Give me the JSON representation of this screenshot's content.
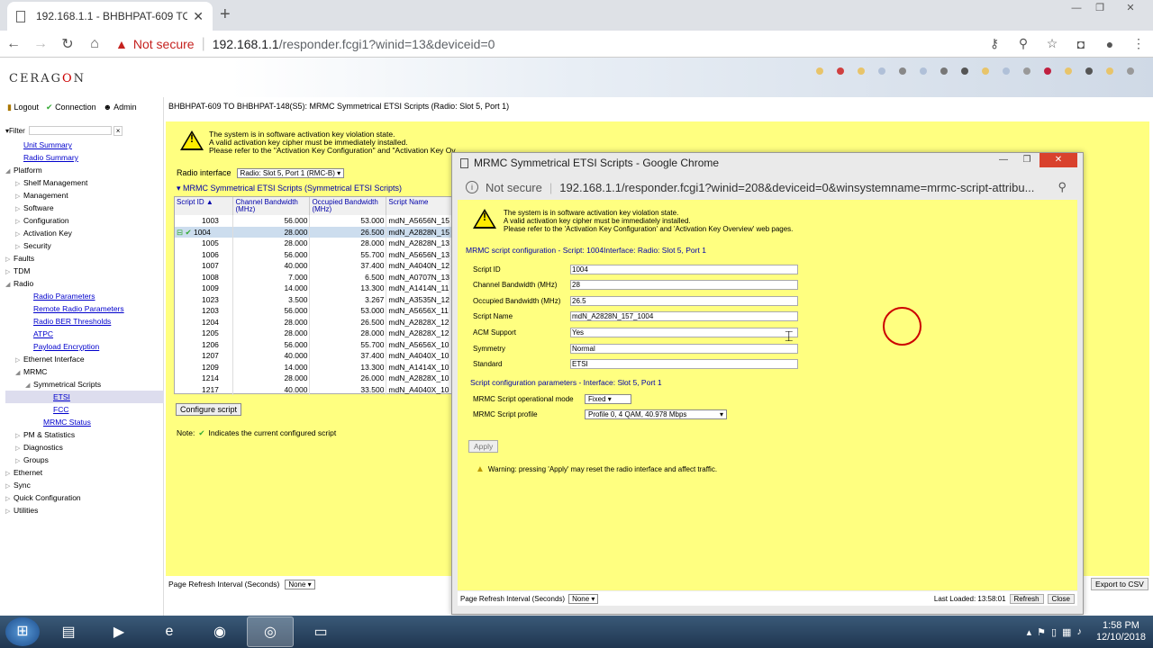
{
  "browser": {
    "tab_title": "192.168.1.1 - BHBHPAT-609 TO B",
    "tab_close": "✕",
    "new_tab": "+",
    "window_buttons": [
      "—",
      "❐",
      "✕"
    ],
    "not_secure": "Not secure",
    "url_host": "192.168.1.1",
    "url_path": "/responder.fcgi1?winid=13&deviceid=0"
  },
  "banner": {
    "logo_pre": "CERAG",
    "logo_o": "O",
    "logo_post": "N",
    "dot_colors": [
      "#e8c46a",
      "#d04040",
      "#e8c46a",
      "#b0c0d8",
      "#888",
      "#b0c0d8",
      "#777",
      "#555",
      "#e8c46a",
      "#b0c0d8",
      "#999",
      "#c02040",
      "#e8c46a",
      "#555",
      "#e8c46a",
      "#999"
    ]
  },
  "topnav": {
    "logout": "Logout",
    "connection": "Connection",
    "admin": "Admin"
  },
  "filter_label": "Filter",
  "tree": [
    {
      "label": "Unit Summary",
      "indent": 1,
      "type": "link"
    },
    {
      "label": "Radio Summary",
      "indent": 1,
      "type": "link"
    },
    {
      "label": "Platform",
      "indent": 0,
      "type": "open"
    },
    {
      "label": "Shelf Management",
      "indent": 1,
      "type": "closed"
    },
    {
      "label": "Management",
      "indent": 1,
      "type": "closed"
    },
    {
      "label": "Software",
      "indent": 1,
      "type": "closed"
    },
    {
      "label": "Configuration",
      "indent": 1,
      "type": "closed"
    },
    {
      "label": "Activation Key",
      "indent": 1,
      "type": "closed"
    },
    {
      "label": "Security",
      "indent": 1,
      "type": "closed"
    },
    {
      "label": "Faults",
      "indent": 0,
      "type": "closed"
    },
    {
      "label": "TDM",
      "indent": 0,
      "type": "closed"
    },
    {
      "label": "Radio",
      "indent": 0,
      "type": "open"
    },
    {
      "label": "Radio Parameters",
      "indent": 2,
      "type": "link"
    },
    {
      "label": "Remote Radio Parameters",
      "indent": 2,
      "type": "link"
    },
    {
      "label": "Radio BER Thresholds",
      "indent": 2,
      "type": "link"
    },
    {
      "label": "ATPC",
      "indent": 2,
      "type": "link"
    },
    {
      "label": "Payload Encryption",
      "indent": 2,
      "type": "link"
    },
    {
      "label": "Ethernet Interface",
      "indent": 1,
      "type": "closed"
    },
    {
      "label": "MRMC",
      "indent": 1,
      "type": "open"
    },
    {
      "label": "Symmetrical Scripts",
      "indent": 2,
      "type": "open"
    },
    {
      "label": "ETSI",
      "indent": 4,
      "type": "sel"
    },
    {
      "label": "FCC",
      "indent": 4,
      "type": "link"
    },
    {
      "label": "MRMC Status",
      "indent": 3,
      "type": "link"
    },
    {
      "label": "PM & Statistics",
      "indent": 1,
      "type": "closed"
    },
    {
      "label": "Diagnostics",
      "indent": 1,
      "type": "closed"
    },
    {
      "label": "Groups",
      "indent": 1,
      "type": "closed"
    },
    {
      "label": "Ethernet",
      "indent": 0,
      "type": "closed"
    },
    {
      "label": "Sync",
      "indent": 0,
      "type": "closed"
    },
    {
      "label": "Quick Configuration",
      "indent": 0,
      "type": "closed"
    },
    {
      "label": "Utilities",
      "indent": 0,
      "type": "closed"
    }
  ],
  "main": {
    "title": "BHBHPAT-609 TO BHBHPAT-148(S5): MRMC Symmetrical ETSI Scripts (Radio: Slot 5, Port 1)",
    "warn1": "The system is in software activation key violation state.",
    "warn2": "A valid activation key cipher must be immediately installed.",
    "warn3": "Please refer to the \"Activation Key Configuration\" and \"Activation Key Ov",
    "radio_interface_label": "Radio interface",
    "radio_interface_value": "Radio: Slot 5, Port 1 (RMC-B)",
    "section_title": "MRMC Symmetrical ETSI Scripts (Symmetrical ETSI Scripts)",
    "columns": [
      "Script ID ▲",
      "Channel Bandwidth (MHz)",
      "Occupied Bandwidth (MHz)",
      "Script Name"
    ],
    "rows": [
      [
        "1003",
        "56.000",
        "53.000",
        "mdN_A5656N_15"
      ],
      [
        "1004",
        "28.000",
        "26.500",
        "mdN_A2828N_15"
      ],
      [
        "1005",
        "28.000",
        "28.000",
        "mdN_A2828N_13"
      ],
      [
        "1006",
        "56.000",
        "55.700",
        "mdN_A5656N_13"
      ],
      [
        "1007",
        "40.000",
        "37.400",
        "mdN_A4040N_12"
      ],
      [
        "1008",
        "7.000",
        "6.500",
        "mdN_A0707N_13"
      ],
      [
        "1009",
        "14.000",
        "13.300",
        "mdN_A1414N_11"
      ],
      [
        "1023",
        "3.500",
        "3.267",
        "mdN_A3535N_12"
      ],
      [
        "1203",
        "56.000",
        "53.000",
        "mdN_A5656X_11"
      ],
      [
        "1204",
        "28.000",
        "26.500",
        "mdN_A2828X_12"
      ],
      [
        "1205",
        "28.000",
        "28.000",
        "mdN_A2828X_12"
      ],
      [
        "1206",
        "56.000",
        "55.700",
        "mdN_A5656X_10"
      ],
      [
        "1207",
        "40.000",
        "37.400",
        "mdN_A4040X_10"
      ],
      [
        "1209",
        "14.000",
        "13.300",
        "mdN_A1414X_10"
      ],
      [
        "1214",
        "28.000",
        "26.000",
        "mdN_A2828X_10"
      ],
      [
        "1217",
        "40.000",
        "33.500",
        "mdN_A4040X_10"
      ]
    ],
    "configure_button": "Configure script",
    "note_label": "Note:",
    "note_text": "Indicates the current configured script",
    "refresh_label": "Page Refresh Interval (Seconds)",
    "refresh_value": "None",
    "export_button": "Export to CSV"
  },
  "popup": {
    "title": "MRMC Symmetrical ETSI Scripts - Google Chrome",
    "not_secure": "Not secure",
    "url": "192.168.1.1/responder.fcgi1?winid=208&deviceid=0&winsystemname=mrmc-script-attribu...",
    "warn1": "The system is in software activation key violation state.",
    "warn2": "A valid activation key cipher must be immediately installed.",
    "warn3": "Please refer to the 'Activation Key Configuration' and 'Activation Key Overview' web pages.",
    "cfg_title": "MRMC script configuration - Script: 1004Interface: Radio: Slot 5, Port 1",
    "fields": [
      {
        "label": "Script ID",
        "value": "1004"
      },
      {
        "label": "Channel Bandwidth (MHz)",
        "value": "28"
      },
      {
        "label": "Occupied Bandwidth (MHz)",
        "value": "26.5"
      },
      {
        "label": "Script Name",
        "value": "mdN_A2828N_157_1004"
      },
      {
        "label": "ACM Support",
        "value": "Yes"
      },
      {
        "label": "Symmetry",
        "value": "Normal"
      },
      {
        "label": "Standard",
        "value": "ETSI"
      }
    ],
    "param_title": "Script configuration parameters - Interface: Slot 5, Port 1",
    "op_mode_label": "MRMC Script operational mode",
    "op_mode_value": "Fixed",
    "profile_label": "MRMC Script profile",
    "profile_value": "Profile 0, 4 QAM, 40.978 Mbps",
    "apply_button": "Apply",
    "warning": "Warning: pressing 'Apply' may reset the radio interface and affect traffic.",
    "refresh_label": "Page Refresh Interval (Seconds)",
    "refresh_value": "None",
    "last_loaded": "Last Loaded: 13:58:01",
    "refresh_button": "Refresh",
    "close_button": "Close"
  },
  "taskbar": {
    "time": "1:58 PM",
    "date": "12/10/2018"
  }
}
